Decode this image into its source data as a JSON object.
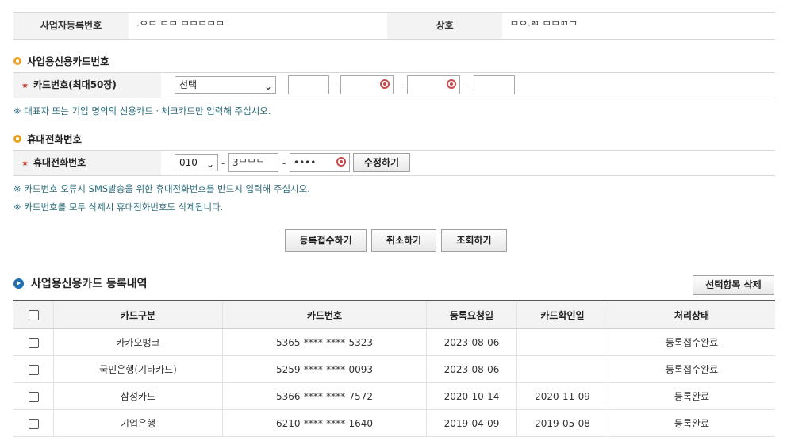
{
  "business": {
    "reg_label": "사업자등록번호",
    "reg_value": "·ᄋᄆ ᄆᄆ ᄆᄆᄆᄆᄆ",
    "name_label": "상호",
    "name_value": "ᄆᄋ·ᄅᄆ ᄆᄆᄆᄀᄀ"
  },
  "card_section": {
    "title": "사업용신용카드번호",
    "label": "카드번호(최대50장)",
    "select_value": "선택",
    "dash": "-",
    "note": "※ 대표자 또는 기업 명의의 신용카드ㆍ체크카드만 입력해 주십시오."
  },
  "phone_section": {
    "title": "휴대전화번호",
    "label": "휴대전화번호",
    "prefix": "010",
    "middle": "3ᄆᄆᄆ",
    "last": "••••",
    "dash": "-",
    "edit_button": "수정하기",
    "note1": "※ 카드번호 오류시 SMS발송을 위한 휴대전화번호를 반드시 입력해 주십시오.",
    "note2": "※ 카드번호를 모두 삭제시 휴대전화번호도 삭제됩니다."
  },
  "actions": {
    "register": "등록접수하기",
    "cancel": "취소하기",
    "lookup": "조회하기"
  },
  "list_section": {
    "title": "사업용신용카드 등록내역",
    "delete_button": "선택항목 삭제",
    "columns": [
      "카드구분",
      "카드번호",
      "등록요청일",
      "카드확인일",
      "처리상태"
    ],
    "rows": [
      {
        "company": "카카오뱅크",
        "number": "5365-****-****-5323",
        "request_date": "2023-08-06",
        "confirm_date": "",
        "status": "등록접수완료"
      },
      {
        "company": "국민은행(기타카드)",
        "number": "5259-****-****-0093",
        "request_date": "2023-08-06",
        "confirm_date": "",
        "status": "등록접수완료"
      },
      {
        "company": "삼성카드",
        "number": "5366-****-****-7572",
        "request_date": "2020-10-14",
        "confirm_date": "2020-11-09",
        "status": "등록완료"
      },
      {
        "company": "기업은행",
        "number": "6210-****-****-1640",
        "request_date": "2019-04-09",
        "confirm_date": "2019-05-08",
        "status": "등록완료"
      }
    ]
  },
  "colors": {
    "section_dot": "#f0a020",
    "list_dot": "#1f6fb2",
    "required_star": "#c0392b",
    "note_text": "#2a6b7a"
  },
  "icons": {
    "section": "orange-bullet-icon",
    "list": "blue-arrow-bullet-icon",
    "mask": "password-eye-icon",
    "dropdown": "chevron-down-icon"
  }
}
